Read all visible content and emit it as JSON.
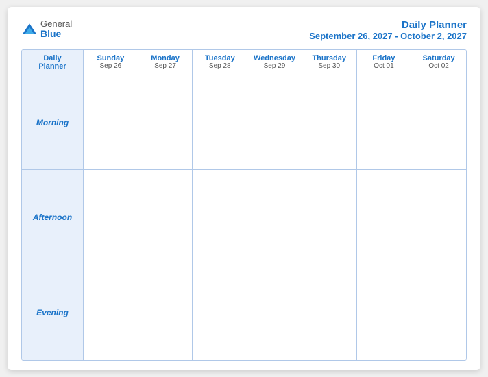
{
  "header": {
    "logo": {
      "general": "General",
      "blue": "Blue"
    },
    "title": "Daily Planner",
    "subtitle": "September 26, 2027 - October 2, 2027"
  },
  "calendar": {
    "columns": [
      {
        "day": "Daily",
        "day2": "Planner",
        "date": ""
      },
      {
        "day": "Sunday",
        "date": "Sep 26"
      },
      {
        "day": "Monday",
        "date": "Sep 27"
      },
      {
        "day": "Tuesday",
        "date": "Sep 28"
      },
      {
        "day": "Wednesday",
        "date": "Sep 29"
      },
      {
        "day": "Thursday",
        "date": "Sep 30"
      },
      {
        "day": "Friday",
        "date": "Oct 01"
      },
      {
        "day": "Saturday",
        "date": "Oct 02"
      }
    ],
    "rows": [
      {
        "label": "Morning"
      },
      {
        "label": "Afternoon"
      },
      {
        "label": "Evening"
      }
    ]
  }
}
